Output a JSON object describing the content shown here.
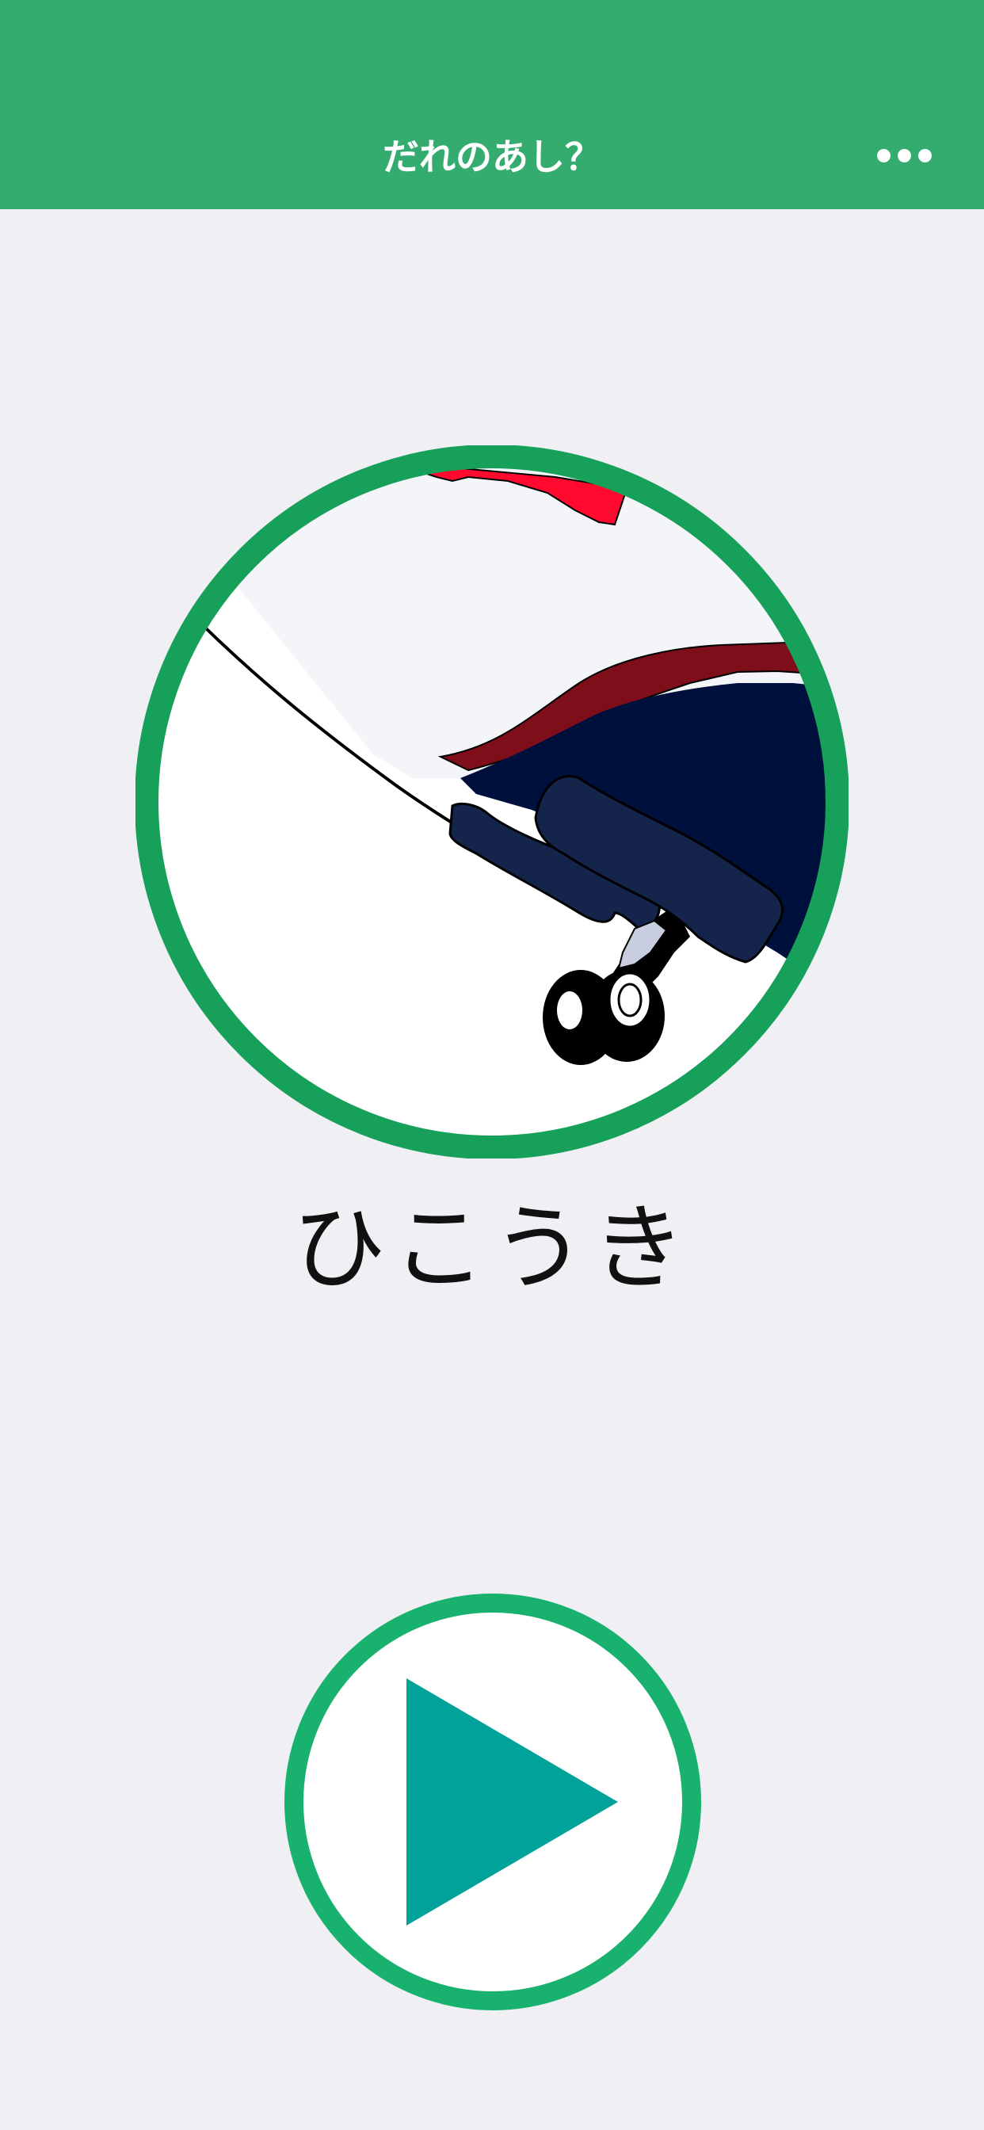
{
  "header": {
    "title": "だれのあし？",
    "menu_icon": "ellipsis-icon",
    "background_color": "#34ac6f"
  },
  "main": {
    "image_description_icon": "airplane-landing-gear-picture",
    "answer_text": "ひこうき",
    "frame_color": "#16a05a"
  },
  "controls": {
    "play_icon": "play-icon",
    "play_ring_color": "#18b16e",
    "play_triangle_color": "#00a29a"
  }
}
